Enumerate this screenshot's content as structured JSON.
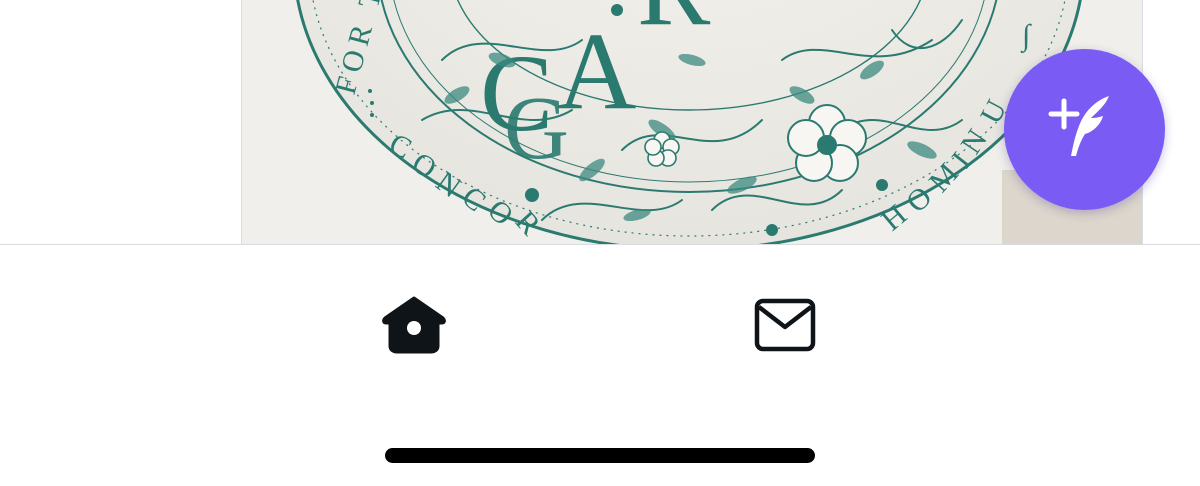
{
  "post": {
    "media": {
      "seal_words": [
        "FOR T",
        "CONCOR",
        "HOMIN",
        "CAR"
      ],
      "ink_color": "#2b7a70",
      "paper_color": "#eeece6"
    }
  },
  "compose_button": {
    "icon": "feather-plus-icon",
    "color": "#7a5cf5"
  },
  "tab_bar": {
    "tabs": [
      {
        "icon": "birdhouse-icon",
        "active": true
      },
      {
        "icon": "envelope-icon",
        "active": false
      }
    ]
  },
  "home_indicator": {
    "color": "#000000"
  }
}
